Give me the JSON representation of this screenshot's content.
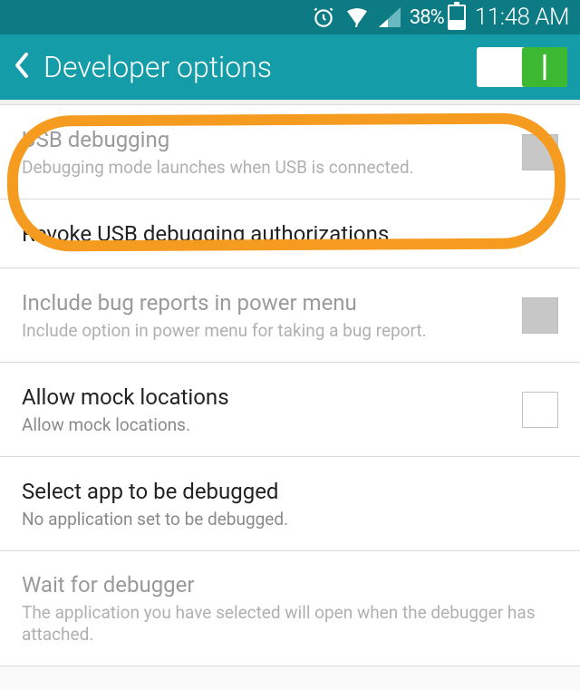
{
  "status": {
    "battery_pct": "38%",
    "time": "11:48 AM"
  },
  "header": {
    "title": "Developer options"
  },
  "rows": {
    "usb_debugging": {
      "title": "USB debugging",
      "sub": "Debugging mode launches when USB is connected."
    },
    "revoke": {
      "title": "Revoke USB debugging authorizations"
    },
    "bug_reports": {
      "title": "Include bug reports in power menu",
      "sub": "Include option in power menu for taking a bug report."
    },
    "mock": {
      "title": "Allow mock locations",
      "sub": "Allow mock locations."
    },
    "select_app": {
      "title": "Select app to be debugged",
      "sub": "No application set to be debugged."
    },
    "wait_debugger": {
      "title": "Wait for debugger",
      "sub": "The application you have selected will open when the debugger has attached."
    }
  }
}
